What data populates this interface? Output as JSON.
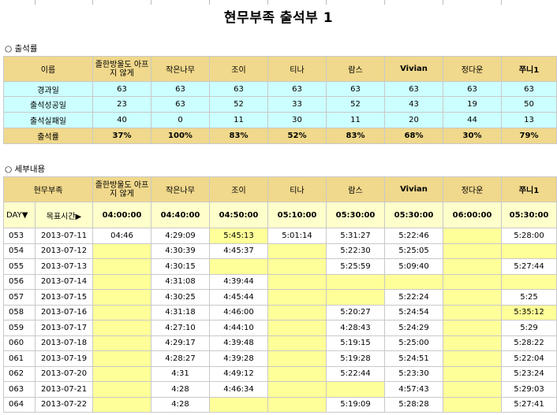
{
  "title": "현무부족 출석부 1",
  "section1": "○ 출석률",
  "section2": "○ 세부내용",
  "names": [
    "졸한방울도\n아프지 않게",
    "작은나무",
    "조이",
    "티나",
    "람스",
    "Vivian",
    "정다운",
    "쭈니1"
  ],
  "summary": {
    "header_label": "이름",
    "rows": [
      {
        "label": "경과일",
        "values": [
          "63",
          "63",
          "63",
          "63",
          "63",
          "63",
          "63",
          "63"
        ]
      },
      {
        "label": "출석성공일",
        "values": [
          "23",
          "63",
          "52",
          "33",
          "52",
          "43",
          "19",
          "50"
        ]
      },
      {
        "label": "출석실패일",
        "values": [
          "40",
          "0",
          "11",
          "30",
          "11",
          "20",
          "44",
          "13"
        ]
      }
    ],
    "rate": {
      "label": "출석률",
      "values": [
        "37%",
        "100%",
        "83%",
        "52%",
        "83%",
        "68%",
        "30%",
        "79%"
      ]
    }
  },
  "detail": {
    "group_label": "현무부족",
    "day_label": "DAY▼",
    "target_label": "목표시간▶",
    "targets": [
      "04:00:00",
      "04:40:00",
      "04:50:00",
      "05:10:00",
      "05:30:00",
      "05:30:00",
      "06:00:00",
      "05:30:00"
    ],
    "rows": [
      {
        "day": "053",
        "date": "2013-07-11",
        "times": [
          "04:46",
          "4:29:09",
          "5:45:13",
          "5:01:14",
          "5:31:27",
          "5:22:46",
          "",
          "5:28:00"
        ]
      },
      {
        "day": "054",
        "date": "2013-07-12",
        "times": [
          "",
          "4:30:39",
          "4:45:37",
          "",
          "5:22:30",
          "5:25:05",
          "",
          ""
        ]
      },
      {
        "day": "055",
        "date": "2013-07-13",
        "times": [
          "",
          "4:30:15",
          "",
          "",
          "5:25:59",
          "5:09:40",
          "",
          "5:27:44"
        ]
      },
      {
        "day": "056",
        "date": "2013-07-14",
        "times": [
          "",
          "4:31:08",
          "4:39:44",
          "",
          "",
          "",
          "",
          ""
        ]
      },
      {
        "day": "057",
        "date": "2013-07-15",
        "times": [
          "",
          "4:30:25",
          "4:45:44",
          "",
          "",
          "5:22:24",
          "",
          "5:25"
        ]
      },
      {
        "day": "058",
        "date": "2013-07-16",
        "times": [
          "",
          "4:31:18",
          "4:46:00",
          "",
          "5:20:27",
          "5:24:54",
          "",
          "5:35:12"
        ]
      },
      {
        "day": "059",
        "date": "2013-07-17",
        "times": [
          "",
          "4:27:10",
          "4:44:10",
          "",
          "4:28:43",
          "5:24:29",
          "",
          "5:29"
        ]
      },
      {
        "day": "060",
        "date": "2013-07-18",
        "times": [
          "",
          "4:29:17",
          "4:39:48",
          "",
          "5:19:15",
          "5:25:00",
          "",
          "5:28:22"
        ]
      },
      {
        "day": "061",
        "date": "2013-07-19",
        "times": [
          "",
          "4:28:27",
          "4:39:28",
          "",
          "5:19:28",
          "5:24:51",
          "",
          "5:22:04"
        ]
      },
      {
        "day": "062",
        "date": "2013-07-20",
        "times": [
          "",
          "4:31",
          "4:49:12",
          "",
          "5:22:44",
          "5:23:30",
          "",
          "5:23:24"
        ]
      },
      {
        "day": "063",
        "date": "2013-07-21",
        "times": [
          "",
          "4:28",
          "4:46:34",
          "",
          "",
          "4:57:43",
          "",
          "5:29:03"
        ]
      },
      {
        "day": "064",
        "date": "2013-07-22",
        "times": [
          "",
          "4:28",
          "",
          "",
          "5:19:09",
          "5:28:28",
          "",
          "5:27:41"
        ]
      }
    ]
  }
}
